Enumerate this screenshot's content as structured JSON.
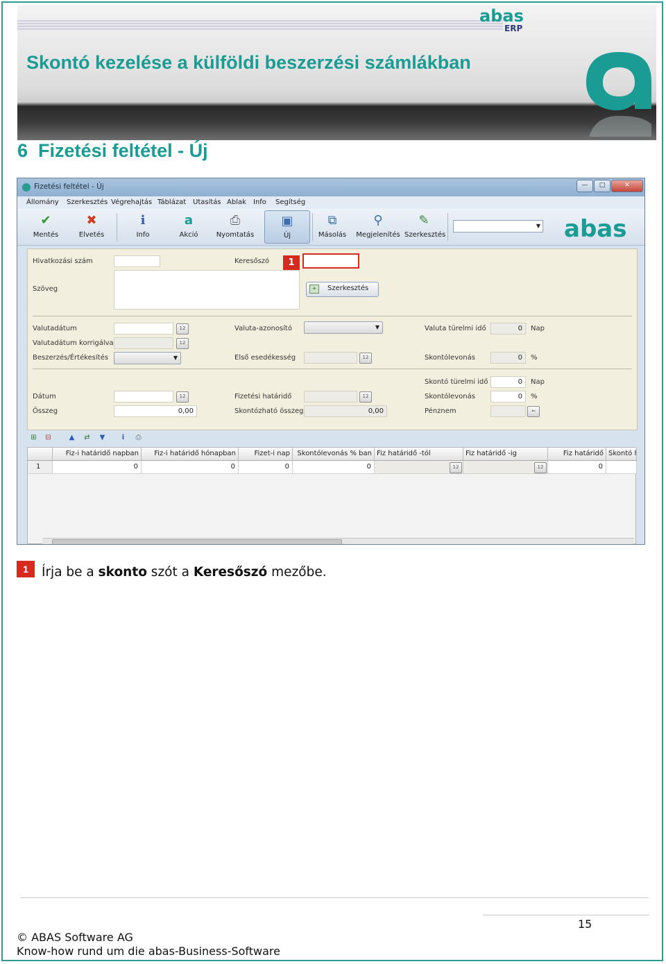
{
  "colors": {
    "accent": "#1a9c95",
    "marker_red": "#d42a1f",
    "border": "#2f9a92"
  },
  "header": {
    "title": "Skontó kezelése a külföldi beszerzési számlákban",
    "logo_text": "abas",
    "logo_sub": "ERP"
  },
  "section": {
    "number": "6",
    "title": "Fizetési feltétel - Új"
  },
  "app": {
    "window_title": "Fizetési feltétel - Új",
    "menu": [
      "Állomány",
      "Szerkesztés",
      "Végrehajtás",
      "Táblázat",
      "Utasítás",
      "Ablak",
      "Info",
      "Segítség"
    ],
    "toolbar": [
      {
        "label": "Mentés",
        "icon": "checkmark-icon"
      },
      {
        "label": "Elvetés",
        "icon": "x-icon"
      },
      {
        "label": "Info",
        "icon": "info-icon"
      },
      {
        "label": "Akció",
        "icon": "abas-a-icon"
      },
      {
        "label": "Nyomtatás",
        "icon": "printer-icon"
      },
      {
        "label": "Új",
        "icon": "new-window-icon"
      },
      {
        "label": "Másolás",
        "icon": "copy-icon"
      },
      {
        "label": "Megjelenítés",
        "icon": "view-icon"
      },
      {
        "label": "Szerkesztés",
        "icon": "edit-icon"
      }
    ],
    "logo": "abas",
    "form": {
      "hivatkozasi_szam": "Hivatkozási szám",
      "keresoszo": "Keresőszó",
      "marker": "1",
      "szoveg": "Szöveg",
      "szerkesztes_btn": "Szerkesztés",
      "valutadatum": "Valutadátum",
      "valutadatum_korrigalva": "Valutadátum korrigálva",
      "beszerzes_ertekesites": "Beszerzés/Értékesítés",
      "valuta_azonosito": "Valuta-azonosító",
      "elso_esedekesseg": "Első esedékesség",
      "valuta_turelmi_ido": "Valuta türelmi idő",
      "valuta_turelmi_ido_value": "0",
      "valuta_turelmi_ido_unit": "Nap",
      "skontolevonas1": "Skontólevonás",
      "skontolevonas1_value": "0",
      "skontolevonas1_unit": "%",
      "skonto_turelmi_ido": "Skontó türelmi idő",
      "skonto_turelmi_ido_value": "0",
      "skonto_turelmi_ido_unit": "Nap",
      "datum": "Dátum",
      "fizetesi_hatarido": "Fizetési határidő",
      "skontolevonas2": "Skontólevonás",
      "skontolevonas2_value": "0",
      "skontolevonas2_unit": "%",
      "osszeg": "Összeg",
      "osszeg_value": "0,00",
      "skontozhato_osszeg": "Skontózható összeg",
      "skontozhato_osszeg_value": "0,00",
      "penznem": "Pénznem",
      "calendar_glyph": "12"
    },
    "grid": {
      "headers": [
        "Fiz-i határidő napban",
        "Fiz-i határidő hónapban",
        "Fizet-i nap",
        "Skontólevonás % ban",
        "Fiz határidő -tól",
        "Fiz határidő -ig",
        "Fiz határidő",
        "Skontó h"
      ],
      "row": {
        "no": "1",
        "cells": [
          "0",
          "0",
          "0",
          "0",
          "",
          "",
          "0",
          ""
        ]
      }
    }
  },
  "instruction": {
    "marker": "1",
    "text1": "Írja be a ",
    "bold1": "skonto",
    "text2": " szót a ",
    "bold2": "Keresőszó",
    "text3": " mezőbe."
  },
  "footer": {
    "page_number": "15",
    "copyright": "© ABAS Software AG",
    "subtitle": "Know-how rund um die abas-Business-Software"
  }
}
